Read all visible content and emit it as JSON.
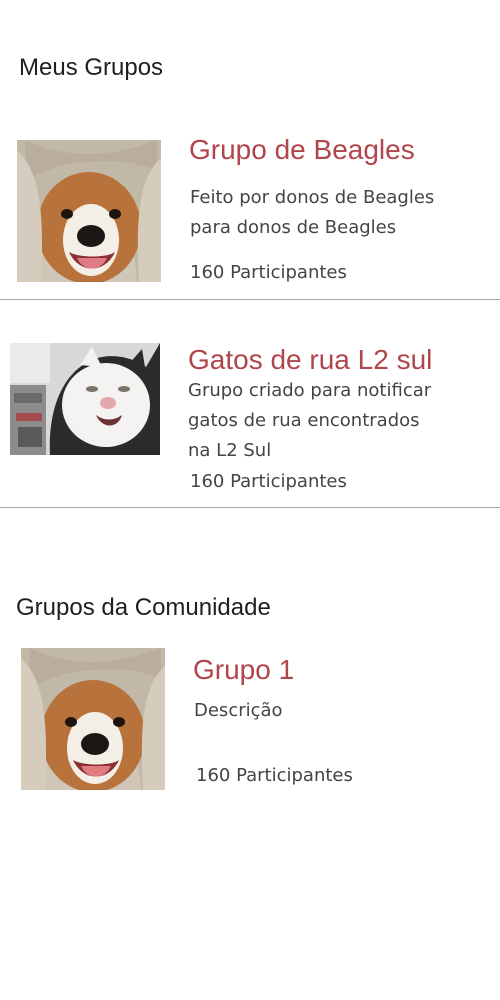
{
  "my_groups": {
    "section_title": "Meus Grupos",
    "groups": [
      {
        "title": "Grupo de Beagles",
        "description": "Feito por donos de Beagles\npara donos de Beagles",
        "members": "160 Participantes",
        "image": "beagle-photo"
      },
      {
        "title": "Gatos de rua L2 sul",
        "description": "Grupo criado para notificar\ngatos de rua encontrados\nna L2 Sul",
        "members": "160 Participantes",
        "image": "cat-photo"
      }
    ]
  },
  "community_groups": {
    "section_title": "Grupos da Comunidade",
    "groups": [
      {
        "title": "Grupo 1",
        "description": "Descrição",
        "members": "160 Participantes",
        "image": "beagle-photo"
      }
    ]
  },
  "colors": {
    "group_title": "#b0454b",
    "body_text": "#444444",
    "divider": "#a9a9a9"
  }
}
